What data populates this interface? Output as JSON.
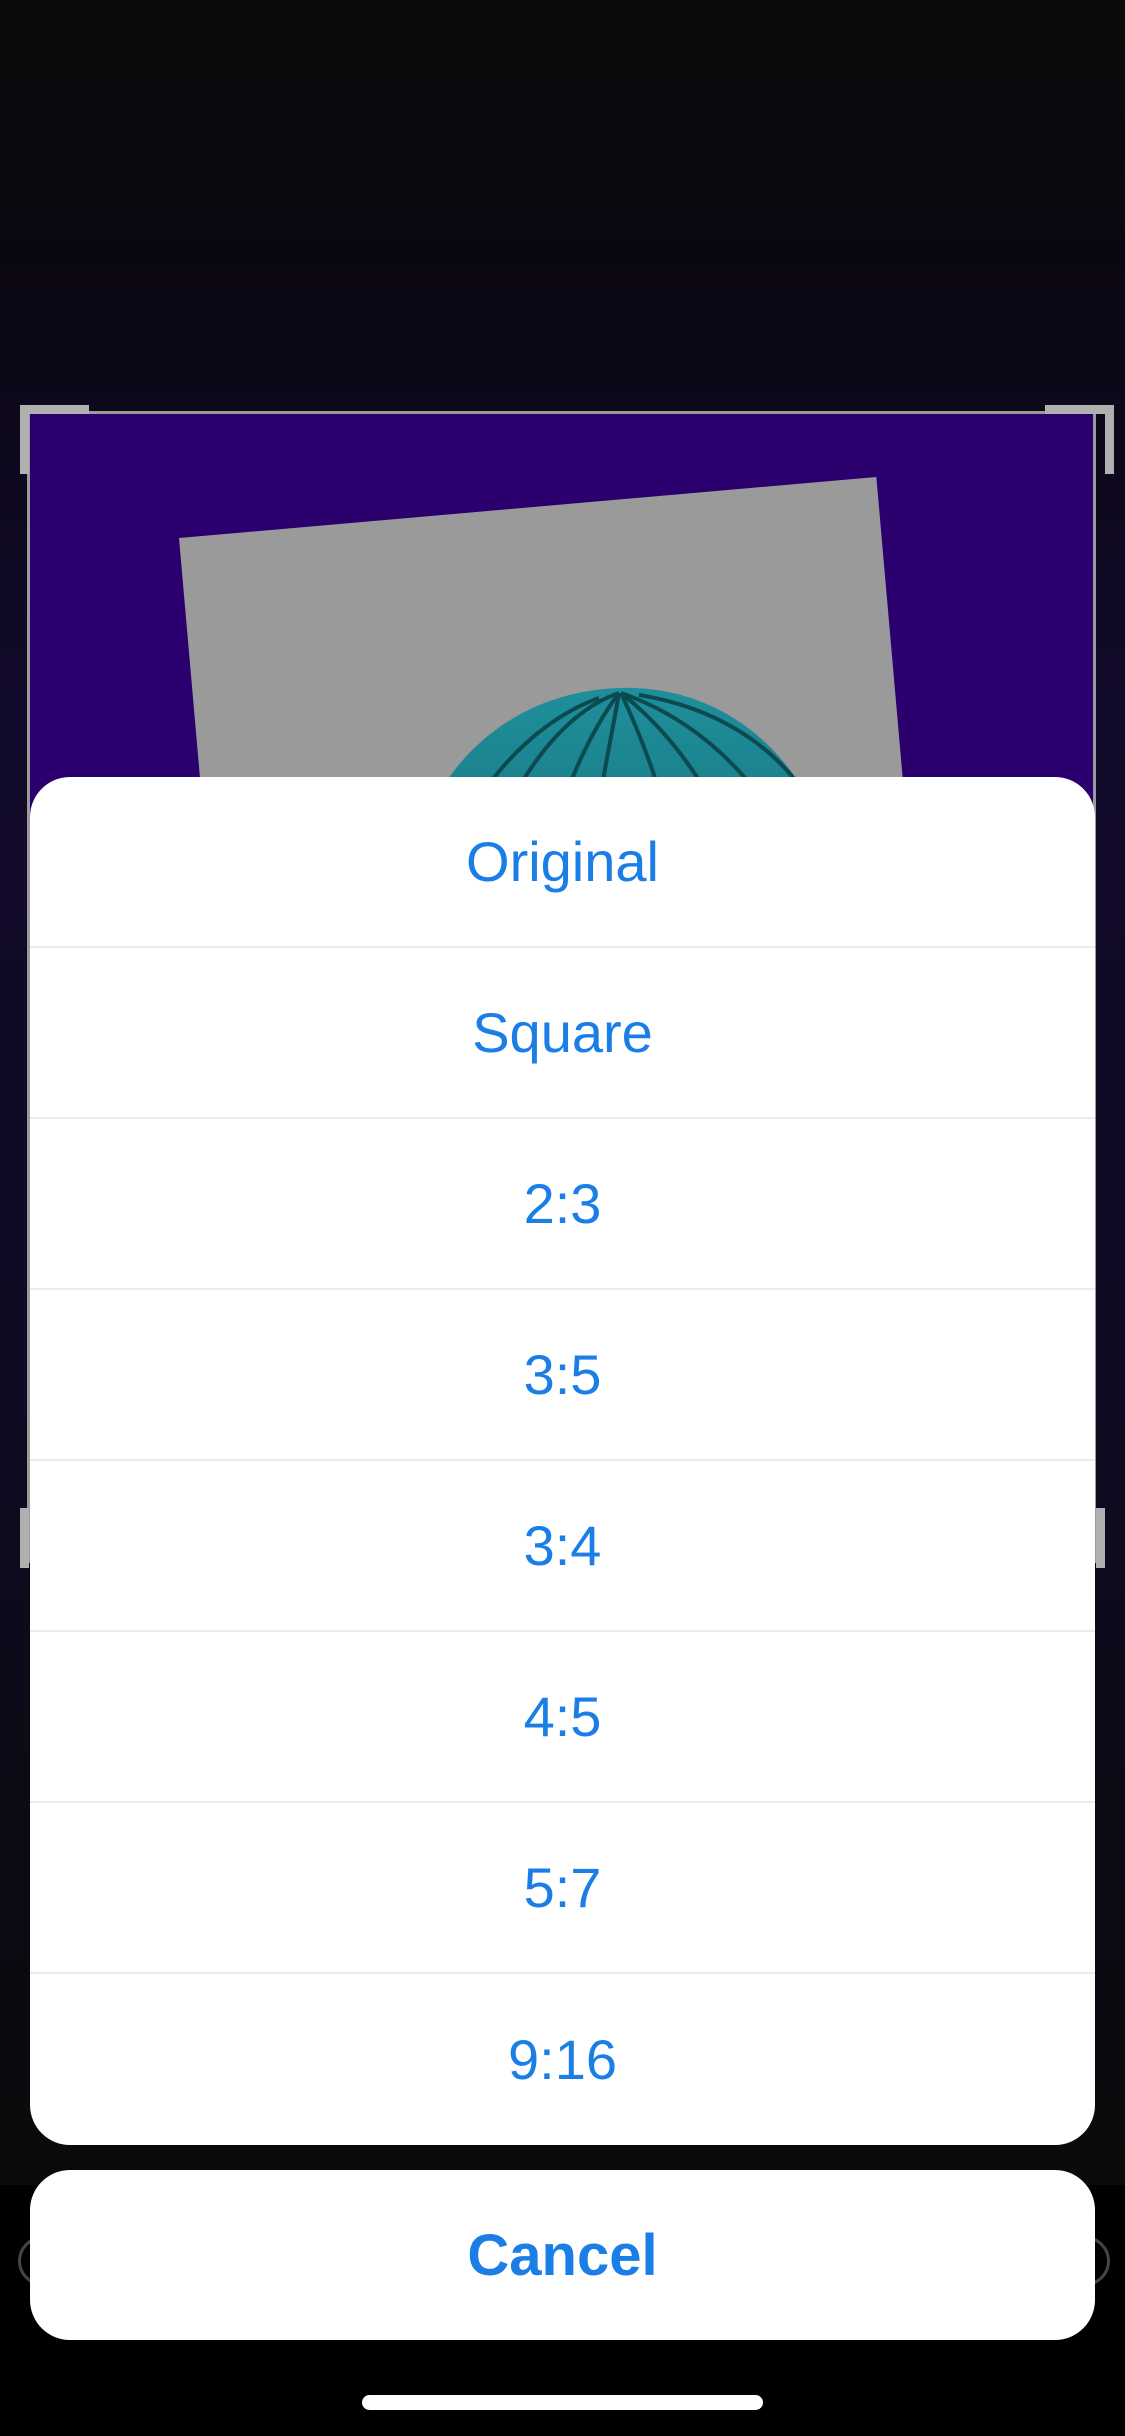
{
  "crop_options": [
    {
      "label": "Original"
    },
    {
      "label": "Square"
    },
    {
      "label": "2:3"
    },
    {
      "label": "3:5"
    },
    {
      "label": "3:4"
    },
    {
      "label": "4:5"
    },
    {
      "label": "5:7"
    },
    {
      "label": "9:16"
    }
  ],
  "cancel_label": "Cancel",
  "colors": {
    "accent": "#1a7ee6",
    "photo_background": "#2b006e",
    "hair": "#1f8a96"
  }
}
